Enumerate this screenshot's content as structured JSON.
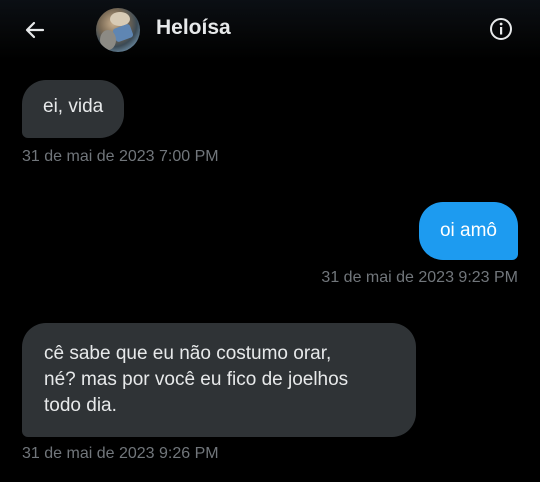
{
  "header": {
    "back_icon": "arrow-left-icon",
    "contact_name": "Heloísa",
    "info_icon": "info-circle-icon"
  },
  "colors": {
    "background": "#000000",
    "received_bubble": "#2f3336",
    "sent_bubble": "#1d9bf0",
    "timestamp": "#71767b"
  },
  "messages": [
    {
      "direction": "received",
      "text": "ei, vida",
      "timestamp": "31 de mai de 2023 7:00 PM"
    },
    {
      "direction": "sent",
      "text": "oi amô",
      "timestamp": "31 de mai de 2023 9:23 PM"
    },
    {
      "direction": "received",
      "text": "cê sabe que eu não costumo orar,\nné? mas por você eu fico de joelhos\ntodo dia.",
      "timestamp": "31 de mai de 2023 9:26 PM"
    }
  ]
}
